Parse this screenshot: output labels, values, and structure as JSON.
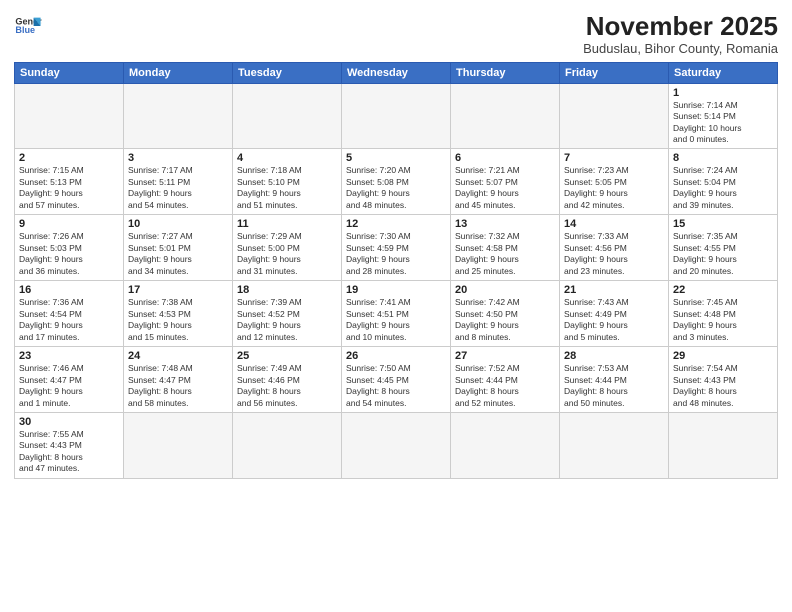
{
  "logo": {
    "line1": "General",
    "line2": "Blue"
  },
  "title": "November 2025",
  "subtitle": "Buduslau, Bihor County, Romania",
  "weekdays": [
    "Sunday",
    "Monday",
    "Tuesday",
    "Wednesday",
    "Thursday",
    "Friday",
    "Saturday"
  ],
  "weeks": [
    [
      {
        "day": "",
        "info": ""
      },
      {
        "day": "",
        "info": ""
      },
      {
        "day": "",
        "info": ""
      },
      {
        "day": "",
        "info": ""
      },
      {
        "day": "",
        "info": ""
      },
      {
        "day": "",
        "info": ""
      },
      {
        "day": "1",
        "info": "Sunrise: 7:14 AM\nSunset: 5:14 PM\nDaylight: 10 hours\nand 0 minutes."
      }
    ],
    [
      {
        "day": "2",
        "info": "Sunrise: 7:15 AM\nSunset: 5:13 PM\nDaylight: 9 hours\nand 57 minutes."
      },
      {
        "day": "3",
        "info": "Sunrise: 7:17 AM\nSunset: 5:11 PM\nDaylight: 9 hours\nand 54 minutes."
      },
      {
        "day": "4",
        "info": "Sunrise: 7:18 AM\nSunset: 5:10 PM\nDaylight: 9 hours\nand 51 minutes."
      },
      {
        "day": "5",
        "info": "Sunrise: 7:20 AM\nSunset: 5:08 PM\nDaylight: 9 hours\nand 48 minutes."
      },
      {
        "day": "6",
        "info": "Sunrise: 7:21 AM\nSunset: 5:07 PM\nDaylight: 9 hours\nand 45 minutes."
      },
      {
        "day": "7",
        "info": "Sunrise: 7:23 AM\nSunset: 5:05 PM\nDaylight: 9 hours\nand 42 minutes."
      },
      {
        "day": "8",
        "info": "Sunrise: 7:24 AM\nSunset: 5:04 PM\nDaylight: 9 hours\nand 39 minutes."
      }
    ],
    [
      {
        "day": "9",
        "info": "Sunrise: 7:26 AM\nSunset: 5:03 PM\nDaylight: 9 hours\nand 36 minutes."
      },
      {
        "day": "10",
        "info": "Sunrise: 7:27 AM\nSunset: 5:01 PM\nDaylight: 9 hours\nand 34 minutes."
      },
      {
        "day": "11",
        "info": "Sunrise: 7:29 AM\nSunset: 5:00 PM\nDaylight: 9 hours\nand 31 minutes."
      },
      {
        "day": "12",
        "info": "Sunrise: 7:30 AM\nSunset: 4:59 PM\nDaylight: 9 hours\nand 28 minutes."
      },
      {
        "day": "13",
        "info": "Sunrise: 7:32 AM\nSunset: 4:58 PM\nDaylight: 9 hours\nand 25 minutes."
      },
      {
        "day": "14",
        "info": "Sunrise: 7:33 AM\nSunset: 4:56 PM\nDaylight: 9 hours\nand 23 minutes."
      },
      {
        "day": "15",
        "info": "Sunrise: 7:35 AM\nSunset: 4:55 PM\nDaylight: 9 hours\nand 20 minutes."
      }
    ],
    [
      {
        "day": "16",
        "info": "Sunrise: 7:36 AM\nSunset: 4:54 PM\nDaylight: 9 hours\nand 17 minutes."
      },
      {
        "day": "17",
        "info": "Sunrise: 7:38 AM\nSunset: 4:53 PM\nDaylight: 9 hours\nand 15 minutes."
      },
      {
        "day": "18",
        "info": "Sunrise: 7:39 AM\nSunset: 4:52 PM\nDaylight: 9 hours\nand 12 minutes."
      },
      {
        "day": "19",
        "info": "Sunrise: 7:41 AM\nSunset: 4:51 PM\nDaylight: 9 hours\nand 10 minutes."
      },
      {
        "day": "20",
        "info": "Sunrise: 7:42 AM\nSunset: 4:50 PM\nDaylight: 9 hours\nand 8 minutes."
      },
      {
        "day": "21",
        "info": "Sunrise: 7:43 AM\nSunset: 4:49 PM\nDaylight: 9 hours\nand 5 minutes."
      },
      {
        "day": "22",
        "info": "Sunrise: 7:45 AM\nSunset: 4:48 PM\nDaylight: 9 hours\nand 3 minutes."
      }
    ],
    [
      {
        "day": "23",
        "info": "Sunrise: 7:46 AM\nSunset: 4:47 PM\nDaylight: 9 hours\nand 1 minute."
      },
      {
        "day": "24",
        "info": "Sunrise: 7:48 AM\nSunset: 4:47 PM\nDaylight: 8 hours\nand 58 minutes."
      },
      {
        "day": "25",
        "info": "Sunrise: 7:49 AM\nSunset: 4:46 PM\nDaylight: 8 hours\nand 56 minutes."
      },
      {
        "day": "26",
        "info": "Sunrise: 7:50 AM\nSunset: 4:45 PM\nDaylight: 8 hours\nand 54 minutes."
      },
      {
        "day": "27",
        "info": "Sunrise: 7:52 AM\nSunset: 4:44 PM\nDaylight: 8 hours\nand 52 minutes."
      },
      {
        "day": "28",
        "info": "Sunrise: 7:53 AM\nSunset: 4:44 PM\nDaylight: 8 hours\nand 50 minutes."
      },
      {
        "day": "29",
        "info": "Sunrise: 7:54 AM\nSunset: 4:43 PM\nDaylight: 8 hours\nand 48 minutes."
      }
    ],
    [
      {
        "day": "30",
        "info": "Sunrise: 7:55 AM\nSunset: 4:43 PM\nDaylight: 8 hours\nand 47 minutes."
      },
      {
        "day": "",
        "info": ""
      },
      {
        "day": "",
        "info": ""
      },
      {
        "day": "",
        "info": ""
      },
      {
        "day": "",
        "info": ""
      },
      {
        "day": "",
        "info": ""
      },
      {
        "day": "",
        "info": ""
      }
    ]
  ]
}
